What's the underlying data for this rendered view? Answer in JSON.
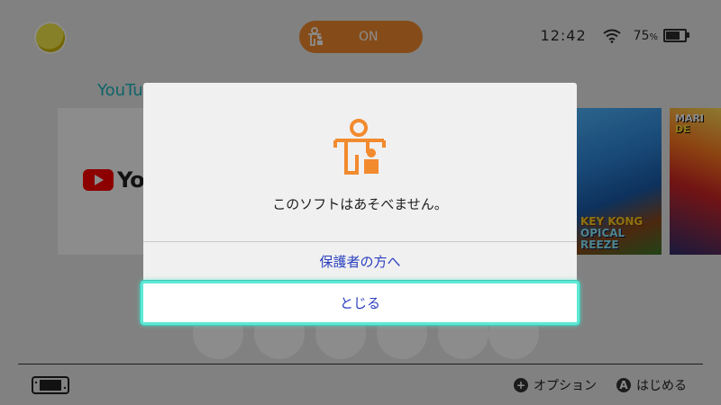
{
  "header": {
    "parental_control": {
      "icon": "parental-control-icon",
      "label": "ON",
      "color": "#f28a2e"
    },
    "status": {
      "time": "12:42",
      "battery_percent": "75",
      "battery_unit": "%"
    }
  },
  "game_title": "YouTu",
  "tiles": {
    "youtube_word": "You",
    "dk_lines": [
      "KEY KONG",
      "OPICAL",
      "REEZE"
    ],
    "mk_lines": [
      "MARI",
      "DE"
    ]
  },
  "dialog": {
    "message": "このソフトはあそべません。",
    "parents_link": "保護者の方へ",
    "close_label": "とじる",
    "accent_color": "#5ee8d5",
    "icon": "parental-control-icon"
  },
  "footer": {
    "options_button": "+",
    "options_label": "オプション",
    "start_button": "A",
    "start_label": "はじめる"
  }
}
